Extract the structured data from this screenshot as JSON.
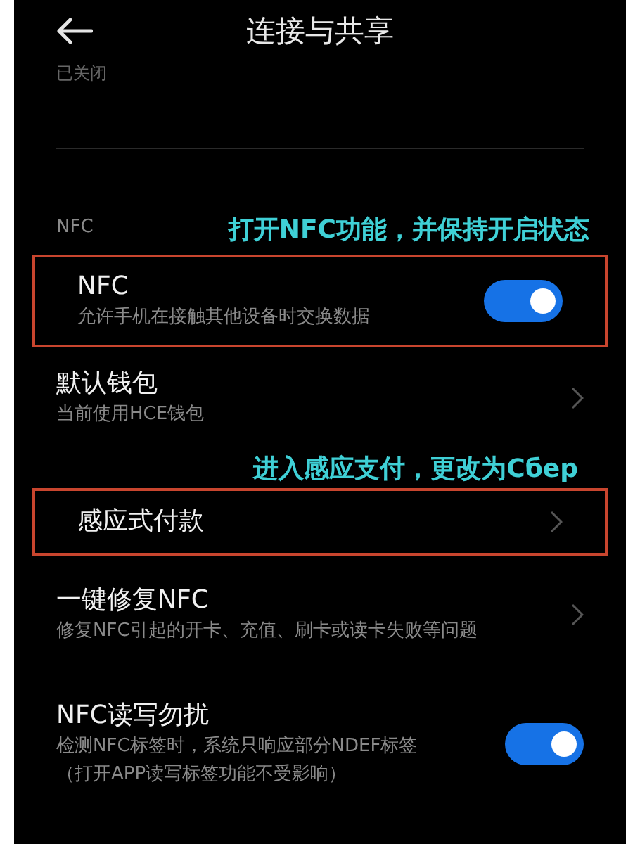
{
  "header": {
    "title": "连接与共享"
  },
  "partial_text": "已关闭",
  "section": {
    "label": "NFC",
    "note": "打开NFC功能，并保持开启状态"
  },
  "items": [
    {
      "kind": "toggle",
      "title": "NFC",
      "subtitle": "允许手机在接触其他设备时交换数据",
      "on": true,
      "highlighted": true
    },
    {
      "kind": "link",
      "title": "默认钱包",
      "subtitle": "当前使用HCE钱包",
      "highlighted": false
    },
    {
      "kind": "link",
      "title": "感应式付款",
      "note": "进入感应支付，更改为Сбер",
      "highlighted": true
    },
    {
      "kind": "link",
      "title": "一键修复NFC",
      "subtitle": "修复NFC引起的开卡、充值、刷卡或读卡失败等问题",
      "highlighted": false
    },
    {
      "kind": "toggle",
      "title": "NFC读写勿扰",
      "subtitle": "检测NFC标签时，系统只响应部分NDEF标签",
      "subtitle_2": "（打开APP读写标签功能不受影响）",
      "on": true,
      "highlighted": false
    }
  ]
}
